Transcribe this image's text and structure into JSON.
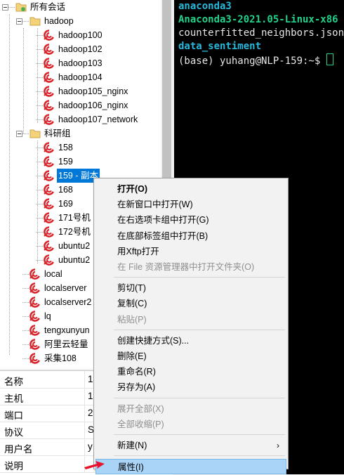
{
  "tree": {
    "root": "所有会话",
    "nodes": [
      {
        "label": "hadoop",
        "type": "folder"
      },
      {
        "label": "hadoop100",
        "type": "session"
      },
      {
        "label": "hadoop102",
        "type": "session"
      },
      {
        "label": "hadoop103",
        "type": "session"
      },
      {
        "label": "hadoop104",
        "type": "session"
      },
      {
        "label": "hadoop105_nginx",
        "type": "session"
      },
      {
        "label": "hadoop106_nginx",
        "type": "session"
      },
      {
        "label": "hadoop107_network",
        "type": "session"
      },
      {
        "label": "科研组",
        "type": "folder"
      },
      {
        "label": "158",
        "type": "session"
      },
      {
        "label": "159",
        "type": "session"
      },
      {
        "label": "159 - 副本",
        "type": "session",
        "selected": true
      },
      {
        "label": "168",
        "type": "session"
      },
      {
        "label": "169",
        "type": "session"
      },
      {
        "label": "171号机",
        "type": "session"
      },
      {
        "label": "172号机",
        "type": "session"
      },
      {
        "label": "ubuntu2",
        "type": "session"
      },
      {
        "label": "ubuntu2",
        "type": "session"
      },
      {
        "label": "local",
        "type": "session"
      },
      {
        "label": "localserver",
        "type": "session"
      },
      {
        "label": "localserver2",
        "type": "session"
      },
      {
        "label": "lq",
        "type": "session"
      },
      {
        "label": "tengxunyun",
        "type": "session"
      },
      {
        "label": "阿里云轻量",
        "type": "session"
      },
      {
        "label": "采集108",
        "type": "session"
      }
    ]
  },
  "terminal": {
    "lines": [
      {
        "text": "anaconda3",
        "color": "blue"
      },
      {
        "text": "Anaconda3-2021.05-Linux-x86",
        "color": "green"
      },
      {
        "text": "counterfitted_neighbors.json",
        "color": "white"
      },
      {
        "text": "data_sentiment",
        "color": "blue"
      },
      {
        "text": "(base) yuhang@NLP-159:~$ ",
        "color": "white"
      }
    ]
  },
  "properties": [
    {
      "key": "名称",
      "value": "1"
    },
    {
      "key": "主机",
      "value": "1"
    },
    {
      "key": "端口",
      "value": "2"
    },
    {
      "key": "协议",
      "value": "S"
    },
    {
      "key": "用户名",
      "value": "y"
    },
    {
      "key": "说明",
      "value": ""
    }
  ],
  "context_menu": {
    "items": [
      {
        "label": "打开(O)",
        "bold": true
      },
      {
        "label": "在新窗口中打开(W)"
      },
      {
        "label": "在右选项卡组中打开(G)"
      },
      {
        "label": "在底部标签组中打开(B)"
      },
      {
        "label": "用Xftp打开"
      },
      {
        "label": "在 File 资源管理器中打开文件夹(O)",
        "disabled": true
      },
      {
        "sep": true
      },
      {
        "label": "剪切(T)"
      },
      {
        "label": "复制(C)"
      },
      {
        "label": "粘贴(P)",
        "disabled": true
      },
      {
        "sep": true
      },
      {
        "label": "创建快捷方式(S)..."
      },
      {
        "label": "删除(E)"
      },
      {
        "label": "重命名(R)"
      },
      {
        "label": "另存为(A)"
      },
      {
        "sep": true
      },
      {
        "label": "展开全部(X)",
        "disabled": true
      },
      {
        "label": "全部收缩(P)",
        "disabled": true
      },
      {
        "sep": true
      },
      {
        "label": "新建(N)",
        "submenu": true
      },
      {
        "sep": true
      },
      {
        "label": "属性(I)",
        "highlighted": true
      }
    ]
  },
  "colors": {
    "selection": "#0078d7",
    "menu_highlight": "#a9d3f7",
    "terminal_blue": "#29b8db",
    "terminal_green": "#23d18b",
    "annotation_arrow": "#e8102a"
  },
  "icons": {
    "session": "xshell-session-icon",
    "folder": "folder-icon",
    "root": "root-sessions-icon",
    "submenu": "chevron-right-icon"
  }
}
